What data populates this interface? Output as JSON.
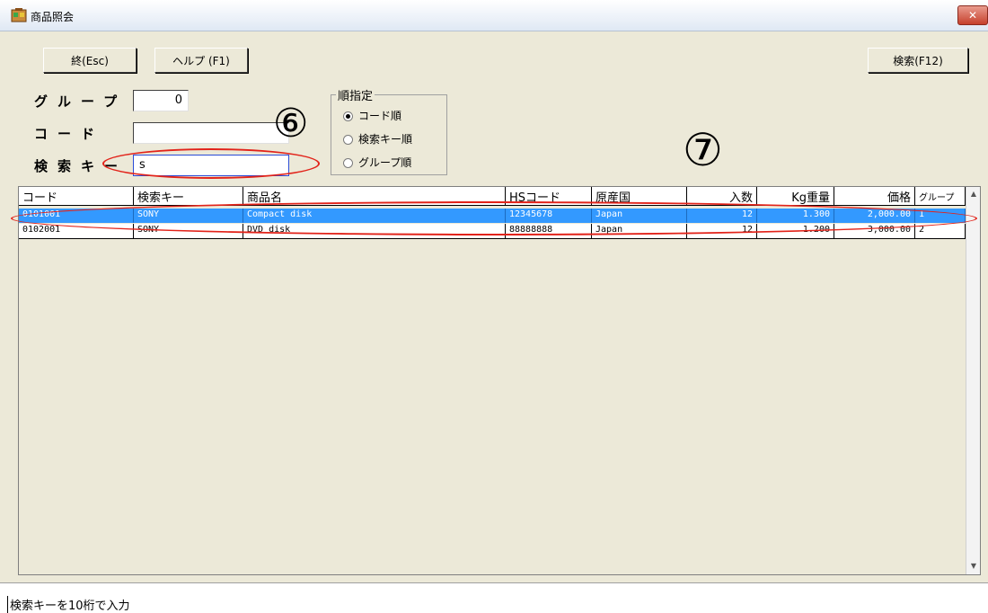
{
  "window": {
    "title": "商品照会",
    "close_glyph": "✕"
  },
  "toolbar": {
    "exit_label": "終(Esc)",
    "help_label": "ヘルプ (F1)",
    "search_label": "検索(F12)"
  },
  "filters": {
    "group_label": "グループ",
    "group_value": "0",
    "code_label": "コード",
    "code_value": "",
    "key_label": "検索キー",
    "key_value": "s"
  },
  "sort": {
    "title": "順指定",
    "options": [
      {
        "label": "コード順",
        "selected": true
      },
      {
        "label": "検索キー順",
        "selected": false
      },
      {
        "label": "グループ順",
        "selected": false
      }
    ]
  },
  "table": {
    "columns": [
      "コード",
      "検索キー",
      "商品名",
      "HSコード",
      "原産国",
      "入数",
      "Kg重量",
      "価格",
      "グループ"
    ],
    "rows": [
      [
        "0101001",
        "SONY",
        "Compact disk",
        "12345678",
        "Japan",
        "12",
        "1.300",
        "2,000.00",
        "1"
      ],
      [
        "0102001",
        "SONY",
        "DVD disk",
        "88888888",
        "Japan",
        "12",
        "1.200",
        "3,000.00",
        "2"
      ]
    ],
    "selected_row": 0
  },
  "scrollbar": {
    "up_glyph": "▲",
    "down_glyph": "▼"
  },
  "status": {
    "text": "検索キーを10桁で入力"
  },
  "annotations": {
    "six": "⑥",
    "seven": "⑦"
  },
  "colors": {
    "selection": "#3399ff",
    "annotation": "#e2231a",
    "window_bg": "#ece9d8"
  }
}
